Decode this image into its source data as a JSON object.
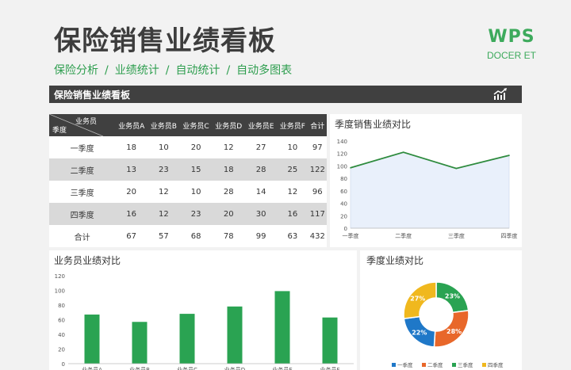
{
  "header": {
    "title": "保险销售业绩看板",
    "subnav": [
      "保险分析",
      "业绩统计",
      "自动统计",
      "自动多图表"
    ],
    "brand_main": "WPS",
    "brand_sub": "DOCER ET"
  },
  "dashboard_bar": {
    "title": "保险销售业绩看板",
    "icon": "chart-trend-icon"
  },
  "table": {
    "corner_top": "业务员",
    "corner_bottom": "季度",
    "columns": [
      "业务员A",
      "业务员B",
      "业务员C",
      "业务员D",
      "业务员E",
      "业务员F",
      "合计"
    ],
    "rows": [
      {
        "label": "一季度",
        "values": [
          "18",
          "10",
          "20",
          "12",
          "27",
          "10",
          "97"
        ]
      },
      {
        "label": "二季度",
        "values": [
          "13",
          "23",
          "15",
          "18",
          "28",
          "25",
          "122"
        ]
      },
      {
        "label": "三季度",
        "values": [
          "20",
          "12",
          "10",
          "28",
          "14",
          "12",
          "96"
        ]
      },
      {
        "label": "四季度",
        "values": [
          "16",
          "12",
          "23",
          "20",
          "30",
          "16",
          "117"
        ]
      },
      {
        "label": "合计",
        "values": [
          "67",
          "57",
          "68",
          "78",
          "99",
          "63",
          "432"
        ]
      }
    ]
  },
  "chart_data": [
    {
      "type": "area",
      "title": "季度销售业绩对比",
      "categories": [
        "一季度",
        "二季度",
        "三季度",
        "四季度"
      ],
      "values": [
        97,
        122,
        96,
        117
      ],
      "ylim": [
        0,
        140
      ],
      "yticks": [
        0,
        20,
        40,
        60,
        80,
        100,
        120,
        140
      ],
      "colors": {
        "line": "#2e8b3e",
        "fill": "#e9f0fb"
      }
    },
    {
      "type": "bar",
      "title": "业务员业绩对比",
      "categories": [
        "业务员A",
        "业务员B",
        "业务员C",
        "业务员D",
        "业务员E",
        "业务员F"
      ],
      "values": [
        67,
        57,
        68,
        78,
        99,
        63
      ],
      "ylim": [
        0,
        120
      ],
      "yticks": [
        0,
        20,
        40,
        60,
        80,
        100,
        120
      ],
      "colors": {
        "bar": "#2aa352"
      }
    },
    {
      "type": "pie",
      "title": "季度业绩对比",
      "categories": [
        "一季度",
        "二季度",
        "三季度",
        "四季度"
      ],
      "values": [
        22,
        28,
        23,
        27
      ],
      "labels": [
        "22%",
        "28%",
        "23%",
        "27%"
      ],
      "colors": [
        "#1f78c8",
        "#e8672a",
        "#2aa352",
        "#f0b81e"
      ],
      "legend": "bottom"
    }
  ]
}
